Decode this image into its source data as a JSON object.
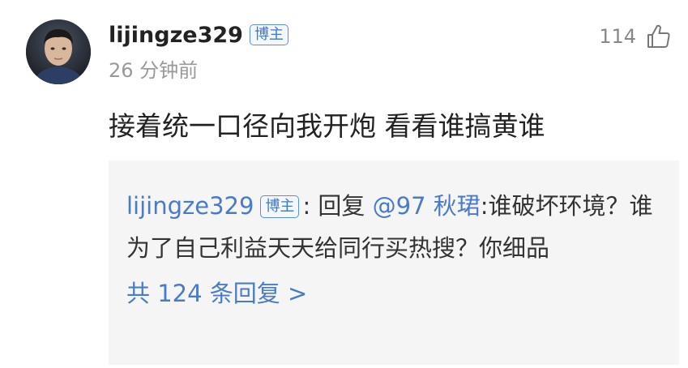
{
  "comment": {
    "username": "lijingze329",
    "badge": "博主",
    "time": "26 分钟前",
    "like_count": "114",
    "content": "接着统一口径向我开炮 看看谁搞黄谁"
  },
  "reply": {
    "username": "lijingze329",
    "badge": "博主",
    "prefix": ": 回复 ",
    "mention": "@97 秋珺",
    "text": ":谁破坏环境？谁为了自己利益天天给同行买热搜？你细品"
  },
  "more_replies": {
    "label": "共 124 条回复 >"
  },
  "colors": {
    "link": "#4a7bcb",
    "badge_border": "#5d8fd6",
    "reply_bg": "#f5f5f5",
    "meta": "#999999"
  }
}
